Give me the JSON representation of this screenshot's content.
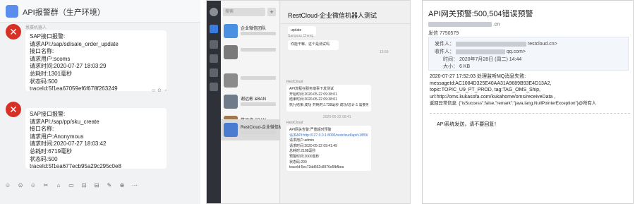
{
  "panel1": {
    "title": "API报警群（生产环境）",
    "messages": [
      {
        "sender": "恩赛机器人",
        "lines": [
          "SAP接口报警:",
          "请求API:/sap/sd/sale_order_update",
          "接口名称:",
          "请求用户:scoms",
          "请求时间:2020-07-27 18:03:29",
          "总耗时:1301毫秒",
          "状态码:500",
          "traceId:5f1ea67059ef6f678f263249"
        ]
      },
      {
        "sender": "",
        "lines": [
          "SAP接口报警:",
          "请求API:/sap/pp/sku_create",
          "接口名称:",
          "请求用户:Anonymous",
          "请求时间:2020-07-27 18:03:42",
          "总耗时:6719毫秒",
          "状态码:500",
          "traceId:5f1ea677ecb95a29c295c0e8"
        ]
      }
    ],
    "toolbar_icons": [
      "☺",
      "⊙",
      "☺",
      "✂",
      "⌂",
      "▭",
      "⊡",
      "⊟",
      "✎",
      "⊕",
      "⋯"
    ]
  },
  "panel2": {
    "search_placeholder": "搜索",
    "plus": "+",
    "list": [
      {
        "name": "企业微信团队"
      },
      {
        "name": ""
      },
      {
        "name": ""
      },
      {
        "name": "谢远彬 &BAN"
      },
      {
        "name": "莫远虎 &BAN"
      },
      {
        "name": ""
      },
      {
        "name": "RestCloud-企业微信机..."
      }
    ],
    "chat_title": "RestCloud-企业微信机器人测试",
    "bubbles": [
      {
        "text": "update"
      },
      {
        "text": "Sampras Cheng"
      },
      {
        "text": "你能干嘛，这个是测试吗"
      }
    ],
    "times": [
      "13:59",
      "2020-05-22 09:41"
    ],
    "alert1": {
      "sender": "RestCloud",
      "lines": [
        "API流程在服务端事下发测试",
        "开始时间:2020-05-22 09:38:01",
        "结束时间:2020-05-22 09:38:01",
        "执行结果:成功 共耗时:1738毫秒 成功/总计:1 需要补偿:0 分"
      ]
    },
    "alert2": {
      "sender": "RestCloud",
      "lines": [
        "API网关告警:严重超时预警",
        "请求API:http://127.0.0.1:8000/restcloud/api/v1/ff/9/...",
        "请求用户:admin",
        "请求时间:2020-05-22 09:41:49",
        "总耗时:2188毫秒",
        "预警时间:2000毫秒",
        "状态码:200",
        "traceId:5ec72dd662c8976e5fbfbea"
      ]
    }
  },
  "panel3": {
    "subject": "API网关预警:500,504错误预警",
    "from_suffix": ".cn",
    "send_no": "发信 7750579",
    "sender_label": "发件人：",
    "sender_suffix": "restcloud.cn>",
    "recipient_label": "收件人：",
    "recipient_suffix": "qq.com>",
    "time_label": "时间：",
    "time_value": "2020年7月28日 (周二) 14:44",
    "size_label": "大小：",
    "size_value": "6 KB",
    "body_lines": [
      "2020-07-27 17:52:03 处理监听MQ消息失败:",
      "messageId:AC1084D325E40AA31A9689B93E4D13A2,",
      "topic:TOPIC_U9_PT_PROD, tag:TAG_OMS_Ship,",
      "url:http://oms.kukasofa.com/kukahome/oms/receiveData ,",
      "返回异常信息: {\"isSuccess\":false,\"remark\":\"java.lang.NullPointerException\"}@所有人"
    ],
    "footer": "API系统发送，请不要回复！"
  }
}
